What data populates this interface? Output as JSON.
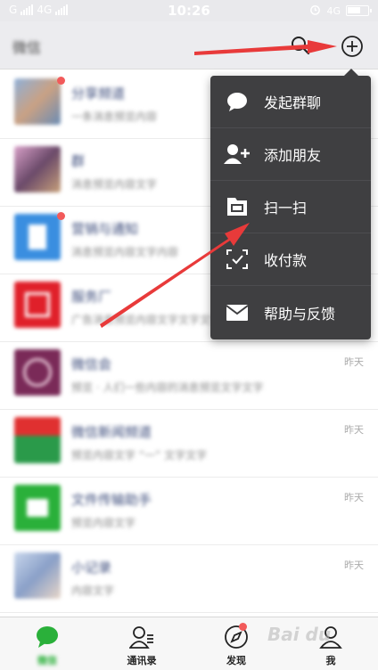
{
  "status_bar": {
    "carrier_left": "G",
    "network": "4G",
    "time": "10:26",
    "network_right": "4G"
  },
  "header": {
    "title": "微信",
    "icons": [
      "search-icon",
      "plus-circle-icon"
    ]
  },
  "chats": [
    {
      "name": "分享频道",
      "message": "一条消息预览内容",
      "time": "",
      "badge": true,
      "avatar_color": "#6a8cb5"
    },
    {
      "name": "群",
      "message": "消息预览内容文字",
      "time": "",
      "badge": false,
      "avatar_color": "#6b4a6a"
    },
    {
      "name": "营销与通知",
      "message": "消息预览内容文字内容",
      "time": "",
      "badge": true,
      "avatar_color": "#3a8ee0"
    },
    {
      "name": "服务厂",
      "message": "广告消息预览内容文字文字文字",
      "time": "",
      "badge": false,
      "avatar_color": "#e0202a"
    },
    {
      "name": "微信会",
      "message": "预览 · 人们一些内容的消息预览文字文字",
      "time": "昨天",
      "badge": false,
      "avatar_color": "#7a2a58"
    },
    {
      "name": "微信新闻频道",
      "message": "预览内容文字 “一” 文字文字",
      "time": "昨天",
      "badge": false,
      "avatar_color": "#2a9a4a"
    },
    {
      "name": "文件传输助手",
      "message": "预览内容文字",
      "time": "昨天",
      "badge": false,
      "avatar_color": "#2ab03a"
    },
    {
      "name": "小记录",
      "message": "内容文字",
      "time": "昨天",
      "badge": false,
      "avatar_color": "#8aa0c8"
    }
  ],
  "menu": {
    "items": [
      {
        "label": "发起群聊",
        "icon": "chat-bubble-icon"
      },
      {
        "label": "添加朋友",
        "icon": "add-friend-icon"
      },
      {
        "label": "扫一扫",
        "icon": "scan-icon"
      },
      {
        "label": "收付款",
        "icon": "payment-scan-icon"
      },
      {
        "label": "帮助与反馈",
        "icon": "mail-icon"
      }
    ]
  },
  "tabbar": {
    "tabs": [
      {
        "label": "微信",
        "icon": "chat-icon",
        "active": true
      },
      {
        "label": "通讯录",
        "icon": "contacts-icon",
        "active": false
      },
      {
        "label": "发现",
        "icon": "compass-icon",
        "active": false,
        "dot": true
      },
      {
        "label": "我",
        "icon": "profile-icon",
        "active": false
      }
    ]
  },
  "colors": {
    "accent": "#2ab03a",
    "menu_bg": "#3f3f41",
    "arrow": "#e83a3a",
    "badge": "#f25a5a"
  }
}
